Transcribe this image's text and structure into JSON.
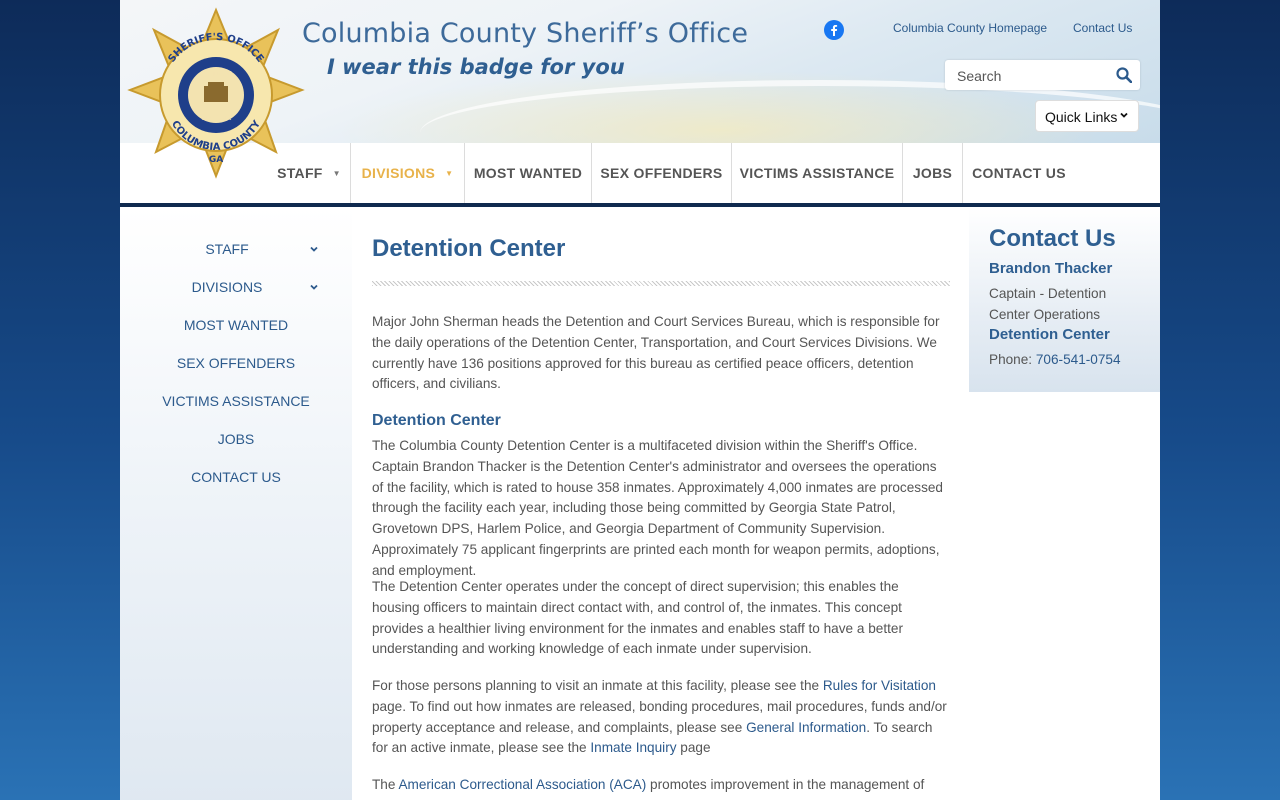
{
  "header": {
    "site_title": "Columbia County Sheriff’s Office",
    "tagline": "I wear this badge for you",
    "badge_text": {
      "top": "SHERIFF'S OFFICE",
      "state_ring": "STATE OF",
      "state": "GEORGIA",
      "bottom": "COLUMBIA COUNTY",
      "abbrev": "GA"
    },
    "top_links": [
      "Columbia County Homepage",
      "Contact Us"
    ],
    "search_placeholder": "Search",
    "quick_links_label": "Quick Links"
  },
  "nav": {
    "items": [
      {
        "label": "STAFF",
        "has_dropdown": true,
        "active": false
      },
      {
        "label": "DIVISIONS",
        "has_dropdown": true,
        "active": true
      },
      {
        "label": "MOST WANTED",
        "has_dropdown": false,
        "active": false
      },
      {
        "label": "SEX OFFENDERS",
        "has_dropdown": false,
        "active": false
      },
      {
        "label": "VICTIMS ASSISTANCE",
        "has_dropdown": false,
        "active": false
      },
      {
        "label": "JOBS",
        "has_dropdown": false,
        "active": false
      },
      {
        "label": "CONTACT US",
        "has_dropdown": false,
        "active": false
      }
    ],
    "active_color": "#e8b24a"
  },
  "sidebar": {
    "items": [
      {
        "label": "STAFF",
        "expandable": true
      },
      {
        "label": "DIVISIONS",
        "expandable": true
      },
      {
        "label": "MOST WANTED",
        "expandable": false
      },
      {
        "label": "SEX OFFENDERS",
        "expandable": false
      },
      {
        "label": "VICTIMS ASSISTANCE",
        "expandable": false
      },
      {
        "label": "JOBS",
        "expandable": false
      },
      {
        "label": "CONTACT US",
        "expandable": false
      }
    ]
  },
  "main": {
    "title": "Detention Center",
    "intro": "Major John Sherman heads the Detention and Court Services Bureau, which is responsible for the daily operations of the Detention Center, Transportation, and Court Services Divisions. We currently have 136 positions approved for this bureau as certified peace officers, detention officers, and civilians.",
    "subheading": "Detention Center",
    "para1": "The Columbia County Detention Center is a multifaceted division within the Sheriff's Office. Captain Brandon Thacker is the Detention Center's administrator and oversees the operations of the facility, which is rated to house 358 inmates. Approximately 4,000 inmates are processed through the facility each year, including those being committed by Georgia State Patrol, Grovetown DPS, Harlem Police, and Georgia Department of Community Supervision. Approximately 75 applicant fingerprints are printed each month for weapon permits, adoptions, and employment.",
    "para2": "The Detention Center operates under the concept of direct supervision; this enables the housing officers to maintain direct contact with, and control of, the inmates. This concept provides a healthier living environment for the inmates and enables staff to have a better understanding and working knowledge of each inmate under supervision.",
    "para3": {
      "t1": "For those persons planning to visit an inmate at this facility, please see the ",
      "link1": "Rules for Visitation",
      "t2": " page. To find out how inmates are released, bonding procedures, mail procedures, funds and/or property acceptance and release, and complaints, please see ",
      "link2": "General Information",
      "t3": ". To search for an active inmate, please see the ",
      "link3": "Inmate Inquiry",
      "t4": " page"
    },
    "para4": {
      "t1": "The ",
      "link1": "American Correctional Association (ACA)",
      "t2": " promotes improvement in the management of jails"
    }
  },
  "contact": {
    "heading": "Contact Us",
    "name": "Brandon Thacker",
    "role": "Captain - Detention Center Operations",
    "unit": "Detention Center",
    "phone_label": "Phone: ",
    "phone": "706-541-0754"
  },
  "colors": {
    "brand_blue": "#2f5f91",
    "link_blue": "#2c5a8c",
    "nav_bar": "#0f2a4f",
    "badge_gold": "#e9c25a"
  }
}
